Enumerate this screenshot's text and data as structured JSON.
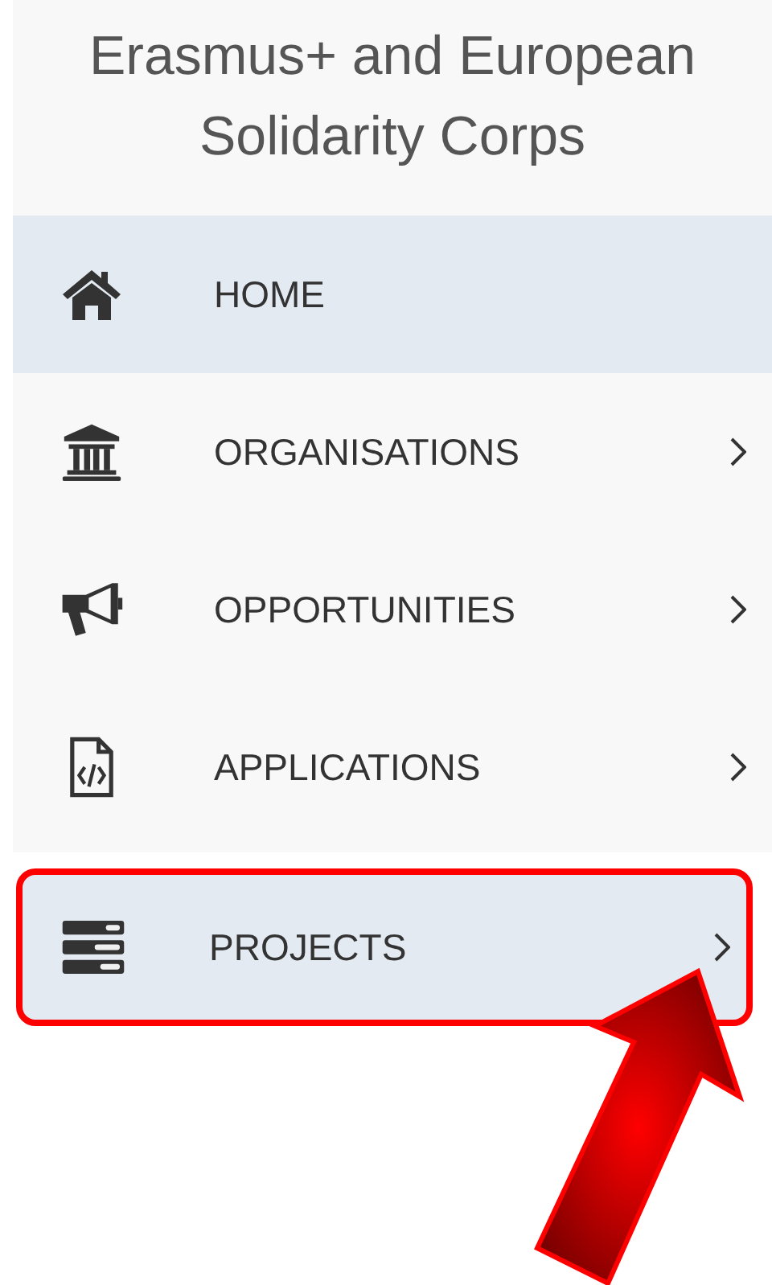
{
  "sidebar": {
    "title": "Erasmus+ and European Solidarity Corps",
    "items": [
      {
        "label": "HOME",
        "kind": "home",
        "selected": true,
        "expandable": false,
        "highlighted": false
      },
      {
        "label": "ORGANISATIONS",
        "kind": "bank",
        "selected": false,
        "expandable": true,
        "highlighted": false
      },
      {
        "label": "OPPORTUNITIES",
        "kind": "megaphone",
        "selected": false,
        "expandable": true,
        "highlighted": false
      },
      {
        "label": "APPLICATIONS",
        "kind": "code-file",
        "selected": false,
        "expandable": true,
        "highlighted": false
      },
      {
        "label": "PROJECTS",
        "kind": "server",
        "selected": true,
        "expandable": true,
        "highlighted": true
      }
    ]
  }
}
